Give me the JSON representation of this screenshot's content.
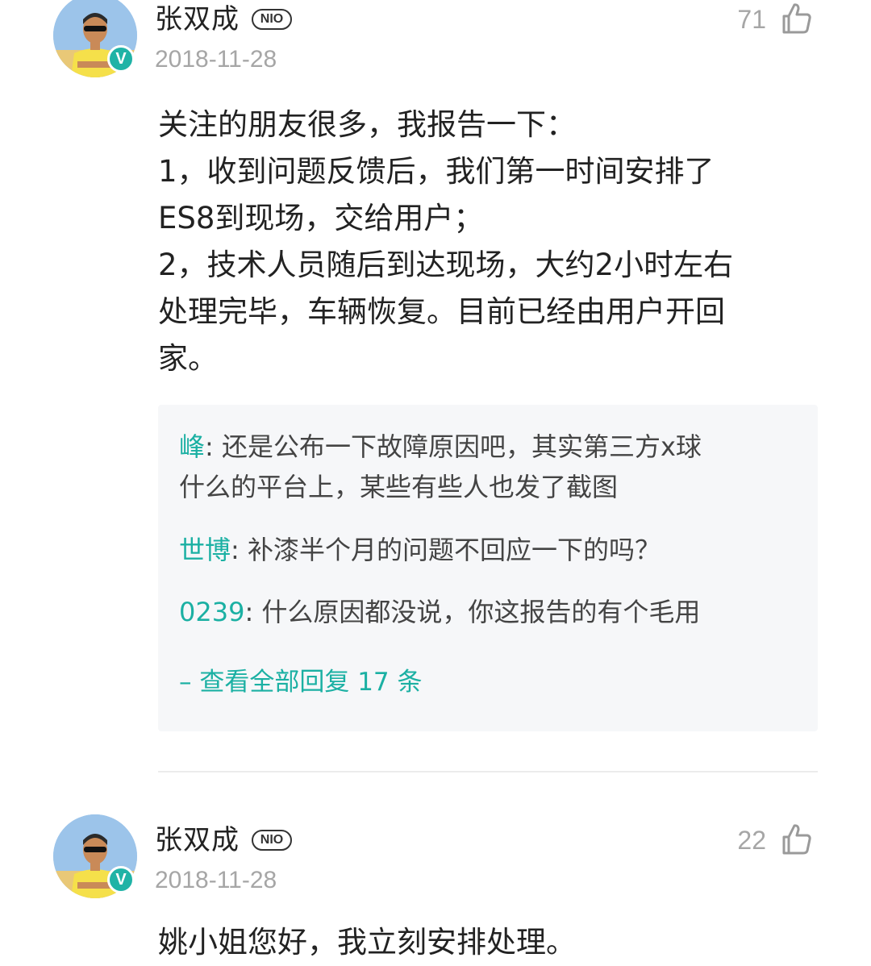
{
  "comments": [
    {
      "username": "张双成",
      "brand_badge": "NIO",
      "verified_mark": "V",
      "date": "2018-11-28",
      "likes": "71",
      "body_lines": [
        "关注的朋友很多，我报告一下：",
        "1，收到问题反馈后，我们第一时间安排了",
        "ES8到现场，交给用户；",
        "2，技术人员随后到达现场，大约2小时左右",
        "处理完毕，车辆恢复。目前已经由用户开回",
        "家。"
      ],
      "replies": [
        {
          "author": "峰",
          "sep": ": ",
          "lines": [
            "还是公布一下故障原因吧，其实第三方x球",
            "什么的平台上，某些有些人也发了截图"
          ]
        },
        {
          "author": "世博",
          "sep": ": ",
          "lines": [
            "补漆半个月的问题不回应一下的吗？"
          ]
        },
        {
          "author": "0239",
          "sep": ": ",
          "lines": [
            "什么原因都没说，你这报告的有个毛用"
          ]
        }
      ],
      "view_all": "– 查看全部回复 17 条"
    },
    {
      "username": "张双成",
      "brand_badge": "NIO",
      "verified_mark": "V",
      "date": "2018-11-28",
      "likes": "22",
      "body_lines": [
        "姚小姐您好，我立刻安排处理。"
      ]
    }
  ],
  "icons": {
    "like": "thumbs-up-icon",
    "verified": "verified-check-icon"
  },
  "colors": {
    "accent": "#1bb0a3",
    "verified": "#1fb3a6",
    "muted": "#a6a6a6",
    "reply_bg": "#f6f7f9"
  }
}
